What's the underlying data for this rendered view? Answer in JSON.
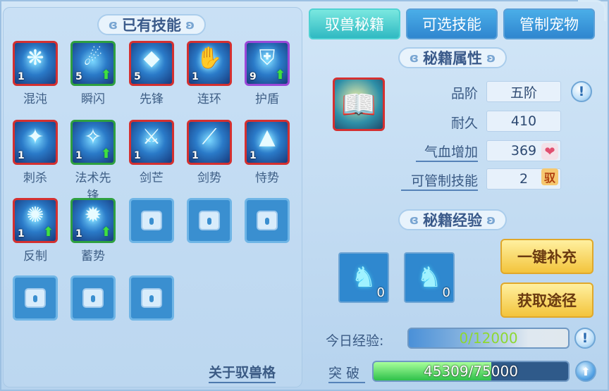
{
  "left_panel": {
    "title": "已有技能",
    "skills": [
      {
        "name": "混沌",
        "level": "1",
        "upgradable": false,
        "glyph": "❋",
        "border": "#d43030"
      },
      {
        "name": "瞬闪",
        "level": "5",
        "upgradable": true,
        "glyph": "☄",
        "border": "#2ea040"
      },
      {
        "name": "先锋",
        "level": "5",
        "upgradable": false,
        "glyph": "◆",
        "border": "#d43030"
      },
      {
        "name": "连环",
        "level": "1",
        "upgradable": false,
        "glyph": "✋",
        "border": "#d43030"
      },
      {
        "name": "护盾",
        "level": "9",
        "upgradable": true,
        "glyph": "⛨",
        "border": "#9a48d8"
      },
      {
        "name": "刺杀",
        "level": "1",
        "upgradable": false,
        "glyph": "✦",
        "border": "#d43030"
      },
      {
        "name": "法术先锋",
        "level": "1",
        "upgradable": true,
        "glyph": "✧",
        "border": "#2ea040"
      },
      {
        "name": "剑芒",
        "level": "1",
        "upgradable": false,
        "glyph": "⚔",
        "border": "#d43030"
      },
      {
        "name": "剑势",
        "level": "1",
        "upgradable": false,
        "glyph": "⟋",
        "border": "#d43030"
      },
      {
        "name": "恃势",
        "level": "1",
        "upgradable": false,
        "glyph": "▲",
        "border": "#d43030"
      },
      {
        "name": "反制",
        "level": "1",
        "upgradable": true,
        "glyph": "✺",
        "border": "#d43030"
      },
      {
        "name": "蓄势",
        "level": "1",
        "upgradable": true,
        "glyph": "✹",
        "border": "#2ea040"
      }
    ],
    "link": "关于驭兽格"
  },
  "tabs": [
    "驭兽秘籍",
    "可选技能",
    "管制宠物"
  ],
  "attributes": {
    "title": "秘籍属性",
    "grade_label": "品阶",
    "grade_value": "五阶",
    "durability_label": "耐久",
    "durability_value": "410",
    "hp_label": "气血增加",
    "hp_value": "369",
    "control_label": "可管制技能",
    "control_value": "2",
    "control_tag": "驭"
  },
  "experience": {
    "title": "秘籍经验",
    "item1_count": "0",
    "item2_count": "0",
    "refill_button": "一键补充",
    "obtain_button": "获取途径",
    "today_label": "今日经验:",
    "today_value": "0/12000",
    "today_fraction": 0.0,
    "break_label": "突 破",
    "break_value": "45309/75000",
    "break_fraction": 0.604
  }
}
